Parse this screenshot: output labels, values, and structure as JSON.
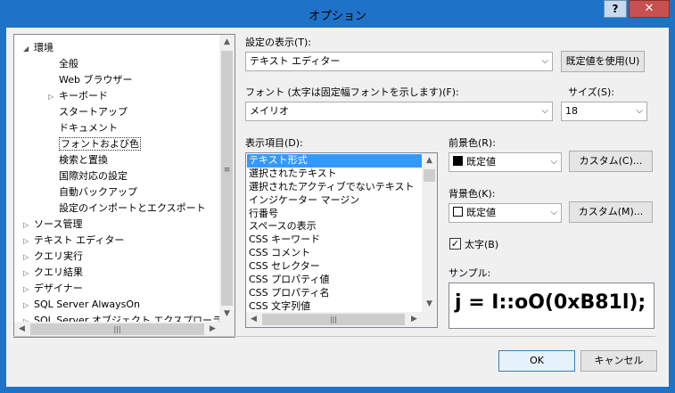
{
  "window": {
    "title": "オプション",
    "help_label": "?",
    "close_label": "✕"
  },
  "tree": {
    "items": [
      {
        "label": "環境",
        "arrow": "◢",
        "level": 0
      },
      {
        "label": "全般",
        "arrow": "",
        "level": 1
      },
      {
        "label": "Web ブラウザー",
        "arrow": "",
        "level": 1
      },
      {
        "label": "キーボード",
        "arrow": "▷",
        "level": 1
      },
      {
        "label": "スタートアップ",
        "arrow": "",
        "level": 1
      },
      {
        "label": "ドキュメント",
        "arrow": "",
        "level": 1
      },
      {
        "label": "フォントおよび色",
        "arrow": "",
        "level": 1,
        "selected": true
      },
      {
        "label": "検索と置換",
        "arrow": "",
        "level": 1
      },
      {
        "label": "国際対応の設定",
        "arrow": "",
        "level": 1
      },
      {
        "label": "自動バックアップ",
        "arrow": "",
        "level": 1
      },
      {
        "label": "設定のインポートとエクスポート",
        "arrow": "",
        "level": 1
      },
      {
        "label": "ソース管理",
        "arrow": "▷",
        "level": 0
      },
      {
        "label": "テキスト エディター",
        "arrow": "▷",
        "level": 0
      },
      {
        "label": "クエリ実行",
        "arrow": "▷",
        "level": 0
      },
      {
        "label": "クエリ結果",
        "arrow": "▷",
        "level": 0
      },
      {
        "label": "デザイナー",
        "arrow": "▷",
        "level": 0
      },
      {
        "label": "SQL Server AlwaysOn",
        "arrow": "▷",
        "level": 0
      },
      {
        "label": "SQL Server オブジェクト エクスプローラー",
        "arrow": "▷",
        "level": 0
      }
    ]
  },
  "settings": {
    "display_label": "設定の表示(T):",
    "display_value": "テキスト エディター",
    "use_defaults_button": "既定値を使用(U)",
    "font_label": "フォント (太字は固定幅フォントを示します)(F):",
    "font_value": "メイリオ",
    "size_label": "サイズ(S):",
    "size_value": "18",
    "items_label": "表示項目(D):",
    "items": [
      "テキスト形式",
      "選択されたテキスト",
      "選択されたアクティブでないテキスト",
      "インジケーター マージン",
      "行番号",
      "スペースの表示",
      "CSS キーワード",
      "CSS コメント",
      "CSS セレクター",
      "CSS プロパティ値",
      "CSS プロパティ名",
      "CSS 文字列値"
    ],
    "foreground_label": "前景色(R):",
    "foreground_value": "既定値",
    "foreground_custom_button": "カスタム(C)...",
    "background_label": "背景色(K):",
    "background_value": "既定値",
    "background_custom_button": "カスタム(M)...",
    "bold_label": "太字(B)",
    "bold_checked": "✓",
    "sample_label": "サンプル:",
    "sample_text": "j = I::oO(0xB81l);"
  },
  "footer": {
    "ok_button": "OK",
    "cancel_button": "キャンセル"
  },
  "colors": {
    "title_bar": "#1e73c9",
    "selection": "#3399ff",
    "close": "#c75050"
  }
}
